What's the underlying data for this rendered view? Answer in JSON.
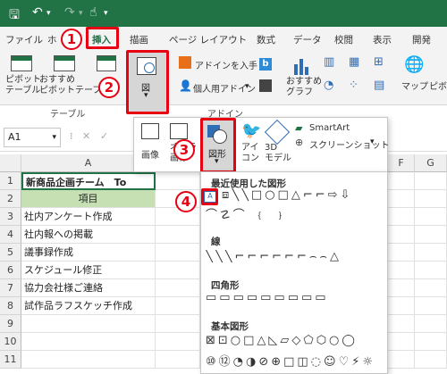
{
  "titlebar": {
    "save_icon": "save-icon",
    "undo_icon": "undo-icon",
    "redo_icon": "redo-icon",
    "touch_icon": "touch-mode-icon"
  },
  "tabs": [
    "ファイル",
    "ホ",
    "挿入",
    "描画",
    "ページ レイアウト",
    "数式",
    "データ",
    "校閲",
    "表示",
    "開発"
  ],
  "ribbon": {
    "pivot_table": "ピボット\nテーブル",
    "recommended_pivot": "おすすめ\nピボットテーブル",
    "table_group_label": "テーブル",
    "illustrations_label": "図",
    "get_addins": "アドインを入手",
    "personal_addins": "個人用アドイン",
    "addins_group_label": "アドイン",
    "recommended_charts": "おすすめ\nグラフ",
    "maps": "マップ",
    "pivot_chart": "ピボット"
  },
  "illustrations_panel": {
    "picture": "画像",
    "online": "オンライン\n画像",
    "shapes": "図形",
    "icons": "アイ\nコン",
    "models_3d": "3D\nモデル",
    "smartart": "SmartArt",
    "screenshot": "スクリーンショット"
  },
  "name_box": "A1",
  "columns": [
    "A",
    "F",
    "G"
  ],
  "rows": [
    {
      "n": "1",
      "a": "新商品企画チーム　To"
    },
    {
      "n": "2",
      "a": "項目"
    },
    {
      "n": "3",
      "a": "社内アンケート作成"
    },
    {
      "n": "4",
      "a": "社内報への掲載"
    },
    {
      "n": "5",
      "a": "議事録作成"
    },
    {
      "n": "6",
      "a": "スケジュール修正"
    },
    {
      "n": "7",
      "a": "協力会社様ご連絡"
    },
    {
      "n": "8",
      "a": "試作品ラフスケッチ作成"
    },
    {
      "n": "9",
      "a": ""
    },
    {
      "n": "10",
      "a": ""
    },
    {
      "n": "11",
      "a": ""
    }
  ],
  "shapes_panel": {
    "recent": "最近使用した図形",
    "lines": "線",
    "rectangles": "四角形",
    "basic": "基本図形"
  },
  "steps": [
    "1",
    "2",
    "3",
    "4"
  ],
  "colors": {
    "accent": "#217346",
    "highlight": "#e60012",
    "header_fill": "#c6e0b4"
  }
}
